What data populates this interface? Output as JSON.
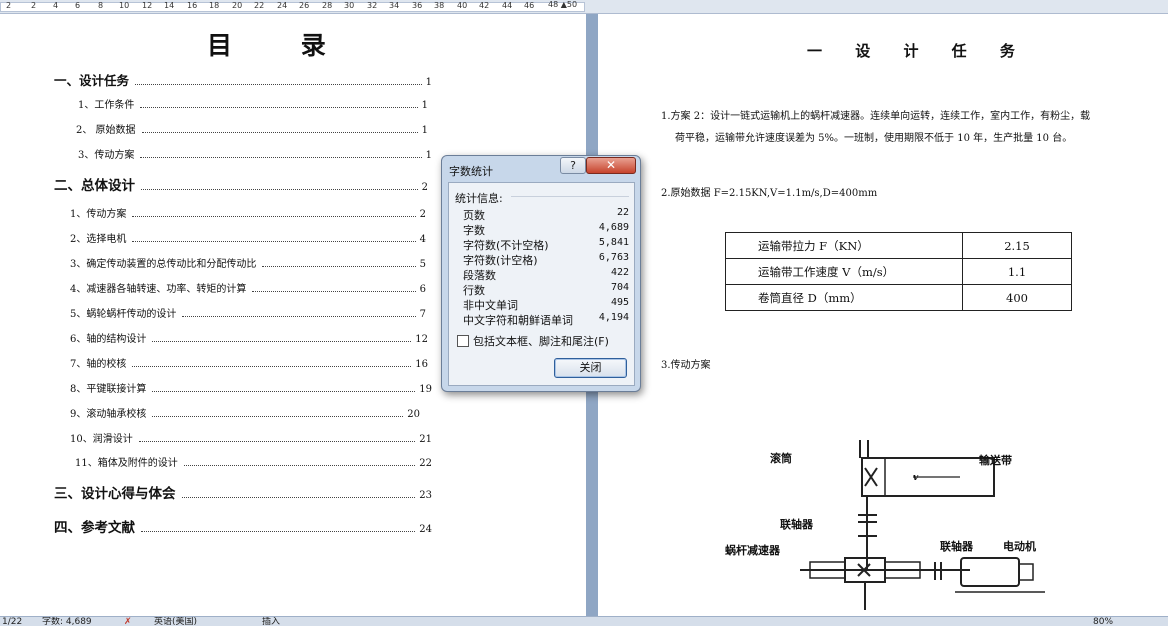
{
  "ruler": {
    "numbers": [
      "2",
      "2",
      "4",
      "6",
      "8",
      "10",
      "12",
      "14",
      "16",
      "18",
      "20",
      "22",
      "24",
      "26",
      "28",
      "30",
      "32",
      "34",
      "36",
      "38",
      "40",
      "42",
      "44",
      "46"
    ],
    "end_label": "48 ▲50"
  },
  "toc": {
    "title": "目  录",
    "entries": [
      {
        "label": "一、设计任务",
        "page": "1",
        "level": 1
      },
      {
        "label": "1、工作条件",
        "page": "1",
        "level": 2
      },
      {
        "label": "2、 原始数据",
        "page": "1",
        "level": 2
      },
      {
        "label": "3、传动方案",
        "page": "1",
        "level": 2
      },
      {
        "label": "二、总体设计",
        "page": "2",
        "level": 1
      },
      {
        "label": "1、传动方案",
        "page": "2",
        "level": 2
      },
      {
        "label": "2、选择电机",
        "page": "4",
        "level": 2
      },
      {
        "label": "3、确定传动装置的总传动比和分配传动比",
        "page": "5",
        "level": 2
      },
      {
        "label": "4、减速器各轴转速、功率、转矩的计算",
        "page": "6",
        "level": 2
      },
      {
        "label": "5、蜗轮蜗杆传动的设计",
        "page": "7",
        "level": 2
      },
      {
        "label": "6、轴的结构设计",
        "page": "12",
        "level": 2
      },
      {
        "label": "7、轴的校核",
        "page": "16",
        "level": 2
      },
      {
        "label": "8、平键联接计算",
        "page": "19",
        "level": 2
      },
      {
        "label": "9、滚动轴承校核",
        "page": "20",
        "level": 2
      },
      {
        "label": "10、润滑设计",
        "page": "21",
        "level": 2
      },
      {
        "label": "11、箱体及附件的设计",
        "page": "22",
        "level": 2
      },
      {
        "label": "三、设计心得与体会",
        "page": "23",
        "level": 1
      },
      {
        "label": "四、参考文献",
        "page": "24",
        "level": 1
      }
    ]
  },
  "right_page": {
    "title": "一 设 计 任 务",
    "para1_line1": "1.方案 2：设计一链式运输机上的蜗杆减速器。连续单向运转，连续工作，室内工作，有粉尘，载",
    "para1_line2": "荷平稳，运输带允许速度误差为 5%。一班制，使用期限不低于 10 年，生产批量 10 台。",
    "para2": "2.原始数据 F=2.15KN,V=1.1m/s,D=400mm",
    "table": [
      {
        "name": "运输带拉力 F（KN）",
        "value": "2.15"
      },
      {
        "name": "运输带工作速度 V（m/s）",
        "value": "1.1"
      },
      {
        "name": "卷筒直径 D（mm）",
        "value": "400"
      }
    ],
    "para3": "3.传动方案",
    "diagram": {
      "drum": "滚筒",
      "belt": "输送带",
      "coupling_top": "联轴器",
      "reducer": "蜗杆减速器",
      "coupling_right": "联轴器",
      "motor": "电动机",
      "belt_arrow": "v"
    }
  },
  "dialog": {
    "title": "字数统计",
    "help": "?",
    "close_x": "✕",
    "stats_label": "统计信息:",
    "stats": [
      {
        "name": "页数",
        "value": "22"
      },
      {
        "name": "字数",
        "value": "4,689"
      },
      {
        "name": "字符数(不计空格)",
        "value": "5,841"
      },
      {
        "name": "字符数(计空格)",
        "value": "6,763"
      },
      {
        "name": "段落数",
        "value": "422"
      },
      {
        "name": "行数",
        "value": "704"
      },
      {
        "name": "非中文单词",
        "value": "495"
      },
      {
        "name": "中文字符和朝鲜语单词",
        "value": "4,194"
      }
    ],
    "checkbox_label": "包括文本框、脚注和尾注(F)",
    "close_button": "关闭"
  },
  "statusbar": {
    "page": "1/22",
    "words": "字数: 4,689",
    "language": "英语(美国)",
    "mode": "插入",
    "zoom": "80%"
  }
}
